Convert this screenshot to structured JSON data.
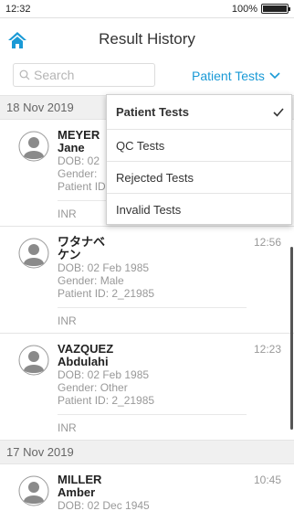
{
  "status_bar": {
    "time": "12:32",
    "battery": "100%",
    "battery_level": 1.0
  },
  "header": {
    "title": "Result History",
    "home_icon": "home-icon"
  },
  "search": {
    "placeholder": "Search"
  },
  "filter": {
    "selected_label": "Patient Tests"
  },
  "filter_menu": {
    "items": [
      {
        "label": "Patient Tests",
        "selected": true
      },
      {
        "label": "QC Tests",
        "selected": false
      },
      {
        "label": "Rejected Tests",
        "selected": false
      },
      {
        "label": "Invalid Tests",
        "selected": false
      }
    ]
  },
  "groups": [
    {
      "date": "18 Nov 2019",
      "results": [
        {
          "last_name": "MEYER",
          "first_name": "Jane",
          "dob": "DOB: 02",
          "gender": "Gender:",
          "patient_id": "Patient ID",
          "time": "",
          "test": "INR"
        },
        {
          "last_name": "ワタナベ",
          "first_name": "ケン",
          "dob": "DOB: 02 Feb 1985",
          "gender": "Gender: Male",
          "patient_id": "Patient ID: 2_21985",
          "time": "12:56",
          "test": "INR"
        },
        {
          "last_name": "VAZQUEZ",
          "first_name": "Abdulahi",
          "dob": "DOB: 02 Feb 1985",
          "gender": "Gender: Other",
          "patient_id": "Patient ID: 2_21985",
          "time": "12:23",
          "test": "INR"
        }
      ]
    },
    {
      "date": "17 Nov 2019",
      "results": [
        {
          "last_name": "MILLER",
          "first_name": "Amber",
          "dob": "DOB: 02 Dec 1945",
          "time": "10:45"
        }
      ]
    }
  ],
  "colors": {
    "accent": "#1a9ad6",
    "date_header_bg": "#f0f0f0",
    "muted_text": "#999999"
  }
}
